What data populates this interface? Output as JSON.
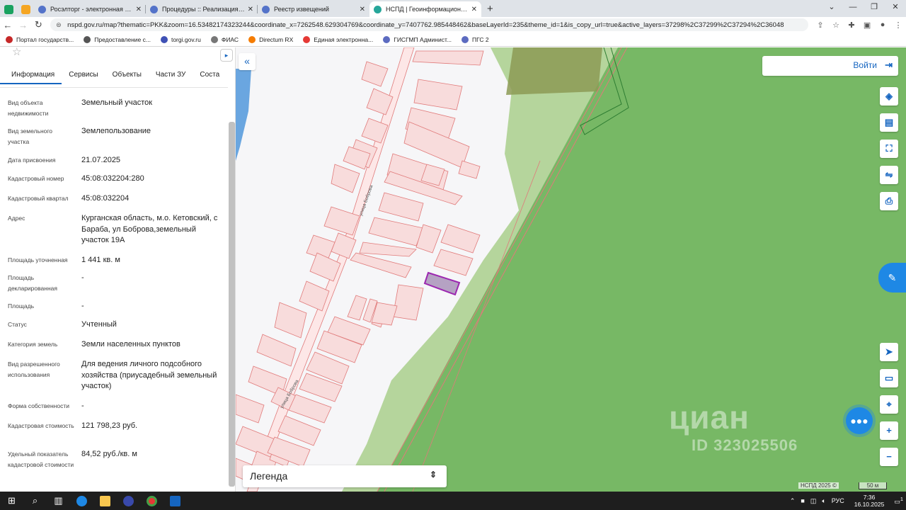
{
  "browser": {
    "tabs": [
      {
        "title": "Росэлторг - электронная торгов",
        "active": false
      },
      {
        "title": "Процедуры :: Реализация госим",
        "active": false
      },
      {
        "title": "Реестр извещений",
        "active": false
      },
      {
        "title": "НСПД | Геоинформационный п",
        "active": true
      }
    ],
    "url": "nspd.gov.ru/map?thematic=PKK&zoom=16.53482174323244&coordinate_x=7262548.629304769&coordinate_y=7407762.985448462&baseLayerId=235&theme_id=1&is_copy_url=true&active_layers=37298%2C37299%2C37294%2C36048",
    "bookmarks": [
      "Портал государств...",
      "Предоставление с...",
      "torgi.gov.ru",
      "ФИАС",
      "Directum RX",
      "Единая электронна...",
      "ГИСГМП Админист...",
      "ПГС 2"
    ]
  },
  "panel": {
    "tabs": [
      "Информация",
      "Сервисы",
      "Объекты",
      "Части ЗУ",
      "Соста"
    ],
    "properties": [
      {
        "label": "Вид объекта недвижимости",
        "value": "Земельный участок"
      },
      {
        "label": "Вид земельного участка",
        "value": "Землепользование"
      },
      {
        "label": "Дата присвоения",
        "value": "21.07.2025"
      },
      {
        "label": "Кадастровый номер",
        "value": "45:08:032204:280"
      },
      {
        "label": "Кадастровый квартал",
        "value": "45:08:032204"
      },
      {
        "label": "Адрес",
        "value": "Курганская область, м.о. Кетовский, с Бараба, ул Боброва,земельный участок 19А"
      },
      {
        "label": "Площадь уточненная",
        "value": "1 441 кв. м"
      },
      {
        "label": "Площадь декларированная",
        "value": "-"
      },
      {
        "label": "Площадь",
        "value": "-"
      },
      {
        "label": "Статус",
        "value": "Учтенный"
      },
      {
        "label": "Категория земель",
        "value": "Земли населенных пунктов"
      },
      {
        "label": "Вид разрешенного использования",
        "value": "Для ведения личного подсобного хозяйства (приусадебный земельный участок)"
      },
      {
        "label": "Форма собственности",
        "value": "-"
      },
      {
        "label": "Кадастровая стоимость",
        "value": "121 798,23 руб."
      },
      {
        "label": "Удельный показатель кадастровой стоимости",
        "value": "84,52 руб./кв. м"
      }
    ]
  },
  "map": {
    "login_label": "Войти",
    "legend_label": "Легенда",
    "street_label": "улица Боброва",
    "watermark_main": "циан",
    "watermark_id": "ID 323025506",
    "attribution": "НСПД 2025 ©",
    "scale": "50 м",
    "colors": {
      "forest": "#77b865",
      "parcel_fill": "#f8dcdc",
      "parcel_stroke": "#e07a7a",
      "selected": "#9c27b0"
    }
  },
  "taskbar": {
    "lang": "РУС",
    "time": "7:36",
    "date": "16.10.2025",
    "notif_count": "1"
  }
}
